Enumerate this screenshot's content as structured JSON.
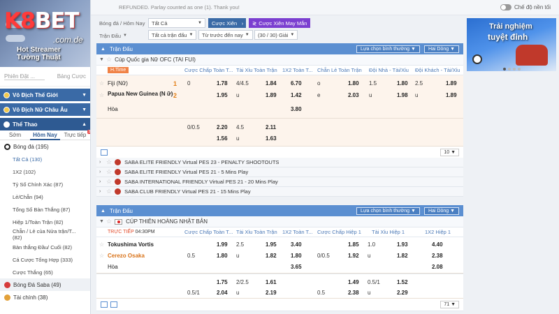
{
  "brand": {
    "logo_main": "K8BET",
    "logo_sub": ".com.de",
    "promo_line1": "Hot Streamer",
    "promo_line2": "Tường Thuật"
  },
  "topbar": {
    "notice": "REFUNDED. Parlay counted as one (1). Thank you!",
    "dark_mode_label": "Chế độ nền tối"
  },
  "filters": {
    "breadcrumb": "Bóng đá / Hôm Nay",
    "league_select": "Tất Cả",
    "parlay_btn": "Cược Xiên",
    "lucky_parlay_btn": "Cược Xiên May Mắn",
    "match_type": "Trận Đấu",
    "all_matches": "Tất cả trận đấu",
    "sort": "Từ trước đến nay",
    "count": "(30 / 30) Giải"
  },
  "sidebar": {
    "sort_label": "Phiên Đặt ...",
    "table_label": "Bảng Cược",
    "world_cup": "Vô Địch Thế Giới",
    "euro": "Vô Địch Nữ Châu Âu",
    "sports": "Thể Thao",
    "tabs": [
      "Sớm",
      "Hôm Nay",
      "Trực tiếp"
    ],
    "live_badge": "30",
    "football": "Bóng đá (195)",
    "sub_items": [
      "Tất Cả (130)",
      "1X2 (102)",
      "Tỷ Số Chính Xác (87)",
      "Lẻ/Chẵn (94)",
      "Tổng Số Bàn Thắng (87)",
      "Hiệp 1/Toàn Trận (82)",
      "Chẵn / Lẻ của Nửa trận/T... (82)",
      "Bàn thắng Đầu/ Cuối (82)",
      "Cá Cược Tổng Hợp (333)",
      "Cược Thắng (65)"
    ],
    "saba_football": "Bóng Đá Saba  (49)",
    "finance": "Tài chính  (38)"
  },
  "promo": {
    "line1": "Trải nghiệm",
    "line2": "tuyệt đỉnh"
  },
  "panel1": {
    "title": "Trận Đấu",
    "ctrl1": "Lựa chọn bình thường",
    "ctrl2": "Hai Dòng",
    "league": "Cúp Quốc gia Nữ OFC (TAI FUI)",
    "time_tag": "H.Time",
    "columns": [
      "Cược Chấp Toàn T...",
      "Tài Xỉu Toàn Trận",
      "1X2 Toàn T...",
      "Chẵn Lẻ Toàn Trận",
      "Đội Nhà - Tài/Xỉu",
      "Đội Khách - Tài/Xỉu"
    ],
    "team1": "Fiji (Nữ)",
    "team2": "Papua New Guinea (N ữ)",
    "draw": "Hòa",
    "score1": "1",
    "score2": "2",
    "r1": [
      "0",
      "1.78",
      "4/4.5",
      "1.84",
      "6.70",
      "o",
      "1.80",
      "1.5",
      "1.80",
      "2.5",
      "1.89"
    ],
    "r2": [
      "1.95",
      "u",
      "1.89",
      "1.42",
      "e",
      "2.03",
      "u",
      "1.98",
      "u",
      "1.89"
    ],
    "r3": [
      "3.80"
    ],
    "alt1": [
      "0/0.5",
      "2.20",
      "4.5",
      "2.11"
    ],
    "alt2": [
      "1.56",
      "u",
      "1.63"
    ],
    "page_size": "10"
  },
  "collapsed_leagues": [
    "SABA ELITE FRIENDLY Virtual PES 23 - PENALTY SHOOTOUTS",
    "SABA ELITE FRIENDLY Virtual PES 21 - 5 Mins Play",
    "SABA INTERNATIONAL FRIENDLY Virtual PES 21 - 20 Mins Play",
    "SABA CLUB FRIENDLY Virtual PES 21 - 15 Mins Play"
  ],
  "panel2": {
    "title": "Trận Đấu",
    "ctrl1": "Lựa chọn bình thường",
    "ctrl2": "Hai Dòng",
    "league": "CÚP THIÊN HOÀNG NHẬT BẢN",
    "live_label": "TRỰC TIẾP",
    "live_time": "04:30PM",
    "columns": [
      "Cược Chấp Toàn T...",
      "Tài Xỉu Toàn Trận",
      "1X2 Toàn T...",
      "Cược Chấp Hiệp 1",
      "Tài Xỉu Hiệp 1",
      "1X2 Hiệp 1"
    ],
    "team1": "Tokushima Vortis",
    "team2": "Cerezo Osaka",
    "draw": "Hòa",
    "r1": [
      "1.99",
      "2.5",
      "1.95",
      "3.40",
      "1.85",
      "1.0",
      "1.93",
      "4.40"
    ],
    "r2": [
      "0.5",
      "1.80",
      "u",
      "1.82",
      "1.80",
      "0/0.5",
      "1.92",
      "u",
      "1.82",
      "2.38"
    ],
    "r3": [
      "3.65",
      "2.08"
    ],
    "alt1": [
      "1.75",
      "2/2.5",
      "1.61",
      "1.49",
      "0.5/1",
      "1.52"
    ],
    "alt2": [
      "0.5/1",
      "2.04",
      "u",
      "2.19",
      "0.5",
      "2.38",
      "u",
      "2.29"
    ],
    "page_size": "71"
  }
}
